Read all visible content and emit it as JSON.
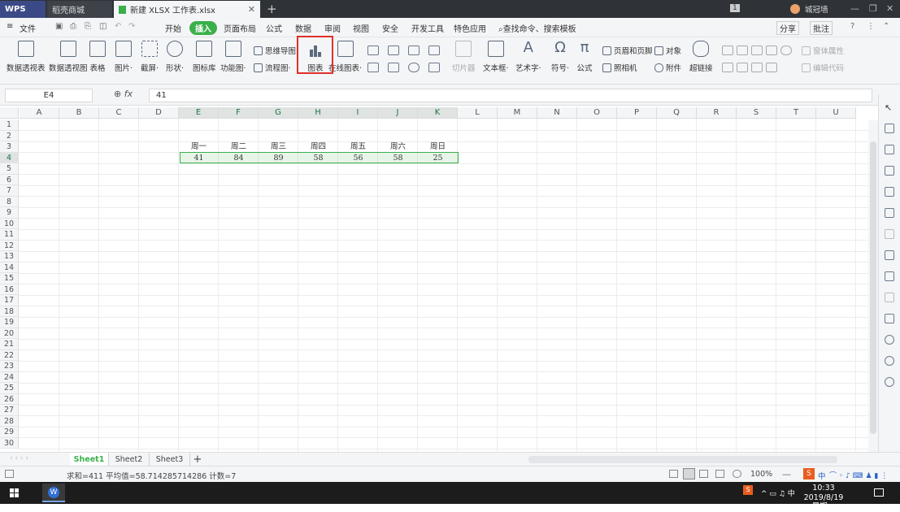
{
  "titlebar": {
    "tabs": [
      {
        "label": "WPS"
      },
      {
        "label": "稻壳商城"
      },
      {
        "label": "新建 XLSX 工作表.xlsx"
      }
    ],
    "user": "城冠墙",
    "badge": "1"
  },
  "menubar": {
    "file": "文件",
    "items": [
      "开始",
      "插入",
      "页面布局",
      "公式",
      "数据",
      "审阅",
      "视图",
      "安全",
      "开发工具",
      "特色应用"
    ],
    "active": "插入",
    "search": "查找命令、搜索模板",
    "share": "分享",
    "comment": "批注"
  },
  "ribbon": {
    "big": [
      "数据透视表",
      "数据透视图",
      "表格",
      "图片·",
      "截屏·",
      "形状·",
      "图标库",
      "功能图·",
      "图表",
      "在线图表·",
      "切片器",
      "文本框·",
      "艺术字·",
      "符号·",
      "公式",
      "超链接"
    ],
    "small": [
      "思维导图·",
      "流程图·",
      "页眉和页脚",
      "对象",
      "照相机",
      "附件",
      "窗体属性",
      "编辑代码"
    ]
  },
  "formula_bar": {
    "cell_ref": "E4",
    "fx": "fx",
    "value": "41"
  },
  "grid": {
    "columns": [
      "A",
      "B",
      "C",
      "D",
      "E",
      "F",
      "G",
      "H",
      "I",
      "J",
      "K",
      "L",
      "M",
      "N",
      "O",
      "P",
      "Q",
      "R",
      "S",
      "T",
      "U"
    ],
    "rows": [
      "1",
      "2",
      "3",
      "4",
      "5",
      "6",
      "7",
      "8",
      "9",
      "10",
      "11",
      "12",
      "13",
      "14",
      "15",
      "16",
      "17",
      "18",
      "19",
      "20",
      "21",
      "22",
      "23",
      "24",
      "25",
      "26",
      "27",
      "28",
      "29",
      "30"
    ],
    "headers_row3": [
      "周一",
      "周二",
      "周三",
      "周四",
      "周五",
      "周六",
      "周日"
    ],
    "values_row4": [
      "41",
      "84",
      "89",
      "58",
      "56",
      "58",
      "25"
    ]
  },
  "sheets": {
    "tabs": [
      "Sheet1",
      "Sheet2",
      "Sheet3"
    ],
    "active": "Sheet1",
    "add": "+"
  },
  "status": {
    "text": "求和=411  平均值=58.714285714286  计数=7",
    "zoom": "100%"
  },
  "taskbar": {
    "time": "10:33",
    "date": "2019/8/19 星期一",
    "ime": "中"
  },
  "colors": {
    "accent": "#3ab04a",
    "highlight": "#e0302b"
  }
}
